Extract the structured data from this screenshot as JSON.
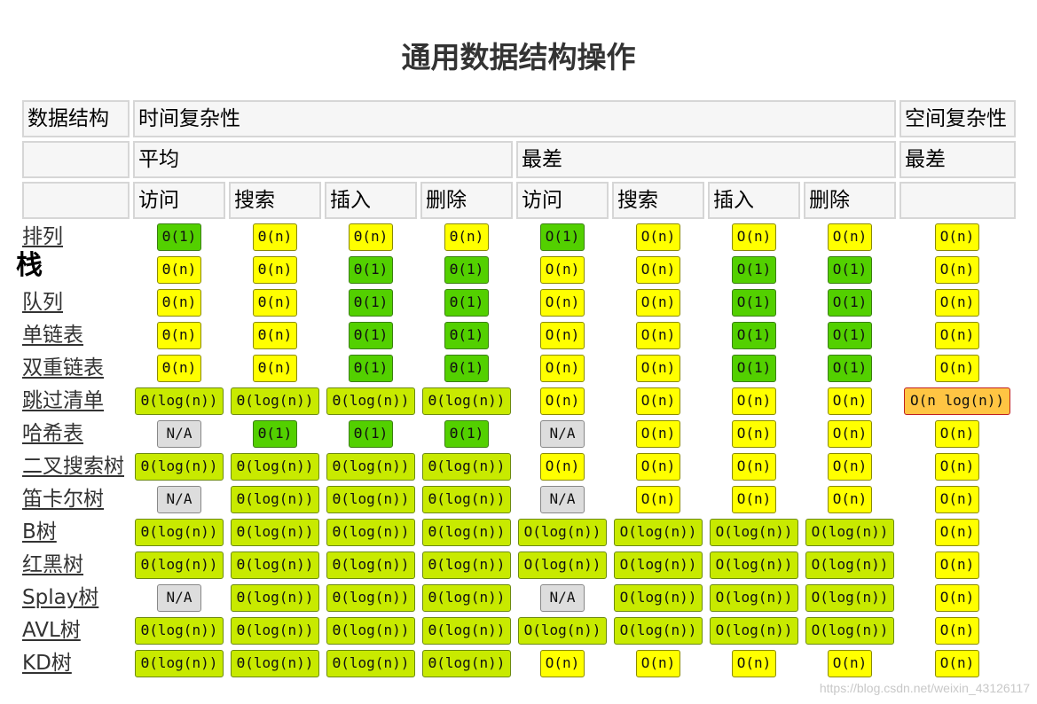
{
  "title": "通用数据结构操作",
  "header": {
    "col_data_structure": "数据结构",
    "col_time": "时间复杂性",
    "col_space": "空间复杂性",
    "avg": "平均",
    "worst": "最差",
    "space_worst": "最差",
    "ops": [
      "访问",
      "搜索",
      "插入",
      "删除",
      "访问",
      "搜索",
      "插入",
      "删除"
    ]
  },
  "colors": {
    "good": "#53d000",
    "fair": "#c8ea00",
    "ok": "#ffff00",
    "bad": "#ffc543",
    "na": "#dddddd"
  },
  "rows": [
    {
      "name": "排列",
      "link": true,
      "cells": [
        {
          "v": "Θ(1)",
          "c": "good"
        },
        {
          "v": "Θ(n)",
          "c": "ok"
        },
        {
          "v": "Θ(n)",
          "c": "ok"
        },
        {
          "v": "Θ(n)",
          "c": "ok"
        },
        {
          "v": "O(1)",
          "c": "good"
        },
        {
          "v": "O(n)",
          "c": "ok"
        },
        {
          "v": "O(n)",
          "c": "ok"
        },
        {
          "v": "O(n)",
          "c": "ok"
        },
        {
          "v": "O(n)",
          "c": "ok"
        }
      ]
    },
    {
      "name": "栈",
      "link": false,
      "cells": [
        {
          "v": "Θ(n)",
          "c": "ok"
        },
        {
          "v": "Θ(n)",
          "c": "ok"
        },
        {
          "v": "Θ(1)",
          "c": "good"
        },
        {
          "v": "Θ(1)",
          "c": "good"
        },
        {
          "v": "O(n)",
          "c": "ok"
        },
        {
          "v": "O(n)",
          "c": "ok"
        },
        {
          "v": "O(1)",
          "c": "good"
        },
        {
          "v": "O(1)",
          "c": "good"
        },
        {
          "v": "O(n)",
          "c": "ok"
        }
      ]
    },
    {
      "name": "队列",
      "link": true,
      "cells": [
        {
          "v": "Θ(n)",
          "c": "ok"
        },
        {
          "v": "Θ(n)",
          "c": "ok"
        },
        {
          "v": "Θ(1)",
          "c": "good"
        },
        {
          "v": "Θ(1)",
          "c": "good"
        },
        {
          "v": "O(n)",
          "c": "ok"
        },
        {
          "v": "O(n)",
          "c": "ok"
        },
        {
          "v": "O(1)",
          "c": "good"
        },
        {
          "v": "O(1)",
          "c": "good"
        },
        {
          "v": "O(n)",
          "c": "ok"
        }
      ]
    },
    {
      "name": "单链表",
      "link": true,
      "cells": [
        {
          "v": "Θ(n)",
          "c": "ok"
        },
        {
          "v": "Θ(n)",
          "c": "ok"
        },
        {
          "v": "Θ(1)",
          "c": "good"
        },
        {
          "v": "Θ(1)",
          "c": "good"
        },
        {
          "v": "O(n)",
          "c": "ok"
        },
        {
          "v": "O(n)",
          "c": "ok"
        },
        {
          "v": "O(1)",
          "c": "good"
        },
        {
          "v": "O(1)",
          "c": "good"
        },
        {
          "v": "O(n)",
          "c": "ok"
        }
      ]
    },
    {
      "name": "双重链表",
      "link": true,
      "cells": [
        {
          "v": "Θ(n)",
          "c": "ok"
        },
        {
          "v": "Θ(n)",
          "c": "ok"
        },
        {
          "v": "Θ(1)",
          "c": "good"
        },
        {
          "v": "Θ(1)",
          "c": "good"
        },
        {
          "v": "O(n)",
          "c": "ok"
        },
        {
          "v": "O(n)",
          "c": "ok"
        },
        {
          "v": "O(1)",
          "c": "good"
        },
        {
          "v": "O(1)",
          "c": "good"
        },
        {
          "v": "O(n)",
          "c": "ok"
        }
      ]
    },
    {
      "name": "跳过清单",
      "link": true,
      "cells": [
        {
          "v": "Θ(log(n))",
          "c": "fair"
        },
        {
          "v": "Θ(log(n))",
          "c": "fair"
        },
        {
          "v": "Θ(log(n))",
          "c": "fair"
        },
        {
          "v": "Θ(log(n))",
          "c": "fair"
        },
        {
          "v": "O(n)",
          "c": "ok"
        },
        {
          "v": "O(n)",
          "c": "ok"
        },
        {
          "v": "O(n)",
          "c": "ok"
        },
        {
          "v": "O(n)",
          "c": "ok"
        },
        {
          "v": "O(n log(n))",
          "c": "bad"
        }
      ]
    },
    {
      "name": "哈希表",
      "link": true,
      "cells": [
        {
          "v": "N/A",
          "c": "na"
        },
        {
          "v": "Θ(1)",
          "c": "good"
        },
        {
          "v": "Θ(1)",
          "c": "good"
        },
        {
          "v": "Θ(1)",
          "c": "good"
        },
        {
          "v": "N/A",
          "c": "na"
        },
        {
          "v": "O(n)",
          "c": "ok"
        },
        {
          "v": "O(n)",
          "c": "ok"
        },
        {
          "v": "O(n)",
          "c": "ok"
        },
        {
          "v": "O(n)",
          "c": "ok"
        }
      ]
    },
    {
      "name": "二叉搜索树",
      "link": true,
      "cells": [
        {
          "v": "Θ(log(n))",
          "c": "fair"
        },
        {
          "v": "Θ(log(n))",
          "c": "fair"
        },
        {
          "v": "Θ(log(n))",
          "c": "fair"
        },
        {
          "v": "Θ(log(n))",
          "c": "fair"
        },
        {
          "v": "O(n)",
          "c": "ok"
        },
        {
          "v": "O(n)",
          "c": "ok"
        },
        {
          "v": "O(n)",
          "c": "ok"
        },
        {
          "v": "O(n)",
          "c": "ok"
        },
        {
          "v": "O(n)",
          "c": "ok"
        }
      ]
    },
    {
      "name": "笛卡尔树",
      "link": true,
      "cells": [
        {
          "v": "N/A",
          "c": "na"
        },
        {
          "v": "Θ(log(n))",
          "c": "fair"
        },
        {
          "v": "Θ(log(n))",
          "c": "fair"
        },
        {
          "v": "Θ(log(n))",
          "c": "fair"
        },
        {
          "v": "N/A",
          "c": "na"
        },
        {
          "v": "O(n)",
          "c": "ok"
        },
        {
          "v": "O(n)",
          "c": "ok"
        },
        {
          "v": "O(n)",
          "c": "ok"
        },
        {
          "v": "O(n)",
          "c": "ok"
        }
      ]
    },
    {
      "name": "B树",
      "link": true,
      "cells": [
        {
          "v": "Θ(log(n))",
          "c": "fair"
        },
        {
          "v": "Θ(log(n))",
          "c": "fair"
        },
        {
          "v": "Θ(log(n))",
          "c": "fair"
        },
        {
          "v": "Θ(log(n))",
          "c": "fair"
        },
        {
          "v": "O(log(n))",
          "c": "fair"
        },
        {
          "v": "O(log(n))",
          "c": "fair"
        },
        {
          "v": "O(log(n))",
          "c": "fair"
        },
        {
          "v": "O(log(n))",
          "c": "fair"
        },
        {
          "v": "O(n)",
          "c": "ok"
        }
      ]
    },
    {
      "name": "红黑树",
      "link": true,
      "cells": [
        {
          "v": "Θ(log(n))",
          "c": "fair"
        },
        {
          "v": "Θ(log(n))",
          "c": "fair"
        },
        {
          "v": "Θ(log(n))",
          "c": "fair"
        },
        {
          "v": "Θ(log(n))",
          "c": "fair"
        },
        {
          "v": "O(log(n))",
          "c": "fair"
        },
        {
          "v": "O(log(n))",
          "c": "fair"
        },
        {
          "v": "O(log(n))",
          "c": "fair"
        },
        {
          "v": "O(log(n))",
          "c": "fair"
        },
        {
          "v": "O(n)",
          "c": "ok"
        }
      ]
    },
    {
      "name": "Splay树",
      "link": true,
      "cells": [
        {
          "v": "N/A",
          "c": "na"
        },
        {
          "v": "Θ(log(n))",
          "c": "fair"
        },
        {
          "v": "Θ(log(n))",
          "c": "fair"
        },
        {
          "v": "Θ(log(n))",
          "c": "fair"
        },
        {
          "v": "N/A",
          "c": "na"
        },
        {
          "v": "O(log(n))",
          "c": "fair"
        },
        {
          "v": "O(log(n))",
          "c": "fair"
        },
        {
          "v": "O(log(n))",
          "c": "fair"
        },
        {
          "v": "O(n)",
          "c": "ok"
        }
      ]
    },
    {
      "name": "AVL树",
      "link": true,
      "cells": [
        {
          "v": "Θ(log(n))",
          "c": "fair"
        },
        {
          "v": "Θ(log(n))",
          "c": "fair"
        },
        {
          "v": "Θ(log(n))",
          "c": "fair"
        },
        {
          "v": "Θ(log(n))",
          "c": "fair"
        },
        {
          "v": "O(log(n))",
          "c": "fair"
        },
        {
          "v": "O(log(n))",
          "c": "fair"
        },
        {
          "v": "O(log(n))",
          "c": "fair"
        },
        {
          "v": "O(log(n))",
          "c": "fair"
        },
        {
          "v": "O(n)",
          "c": "ok"
        }
      ]
    },
    {
      "name": "KD树",
      "link": true,
      "cells": [
        {
          "v": "Θ(log(n))",
          "c": "fair"
        },
        {
          "v": "Θ(log(n))",
          "c": "fair"
        },
        {
          "v": "Θ(log(n))",
          "c": "fair"
        },
        {
          "v": "Θ(log(n))",
          "c": "fair"
        },
        {
          "v": "O(n)",
          "c": "ok"
        },
        {
          "v": "O(n)",
          "c": "ok"
        },
        {
          "v": "O(n)",
          "c": "ok"
        },
        {
          "v": "O(n)",
          "c": "ok"
        },
        {
          "v": "O(n)",
          "c": "ok"
        }
      ]
    }
  ],
  "watermark": "https://blog.csdn.net/weixin_43126117"
}
